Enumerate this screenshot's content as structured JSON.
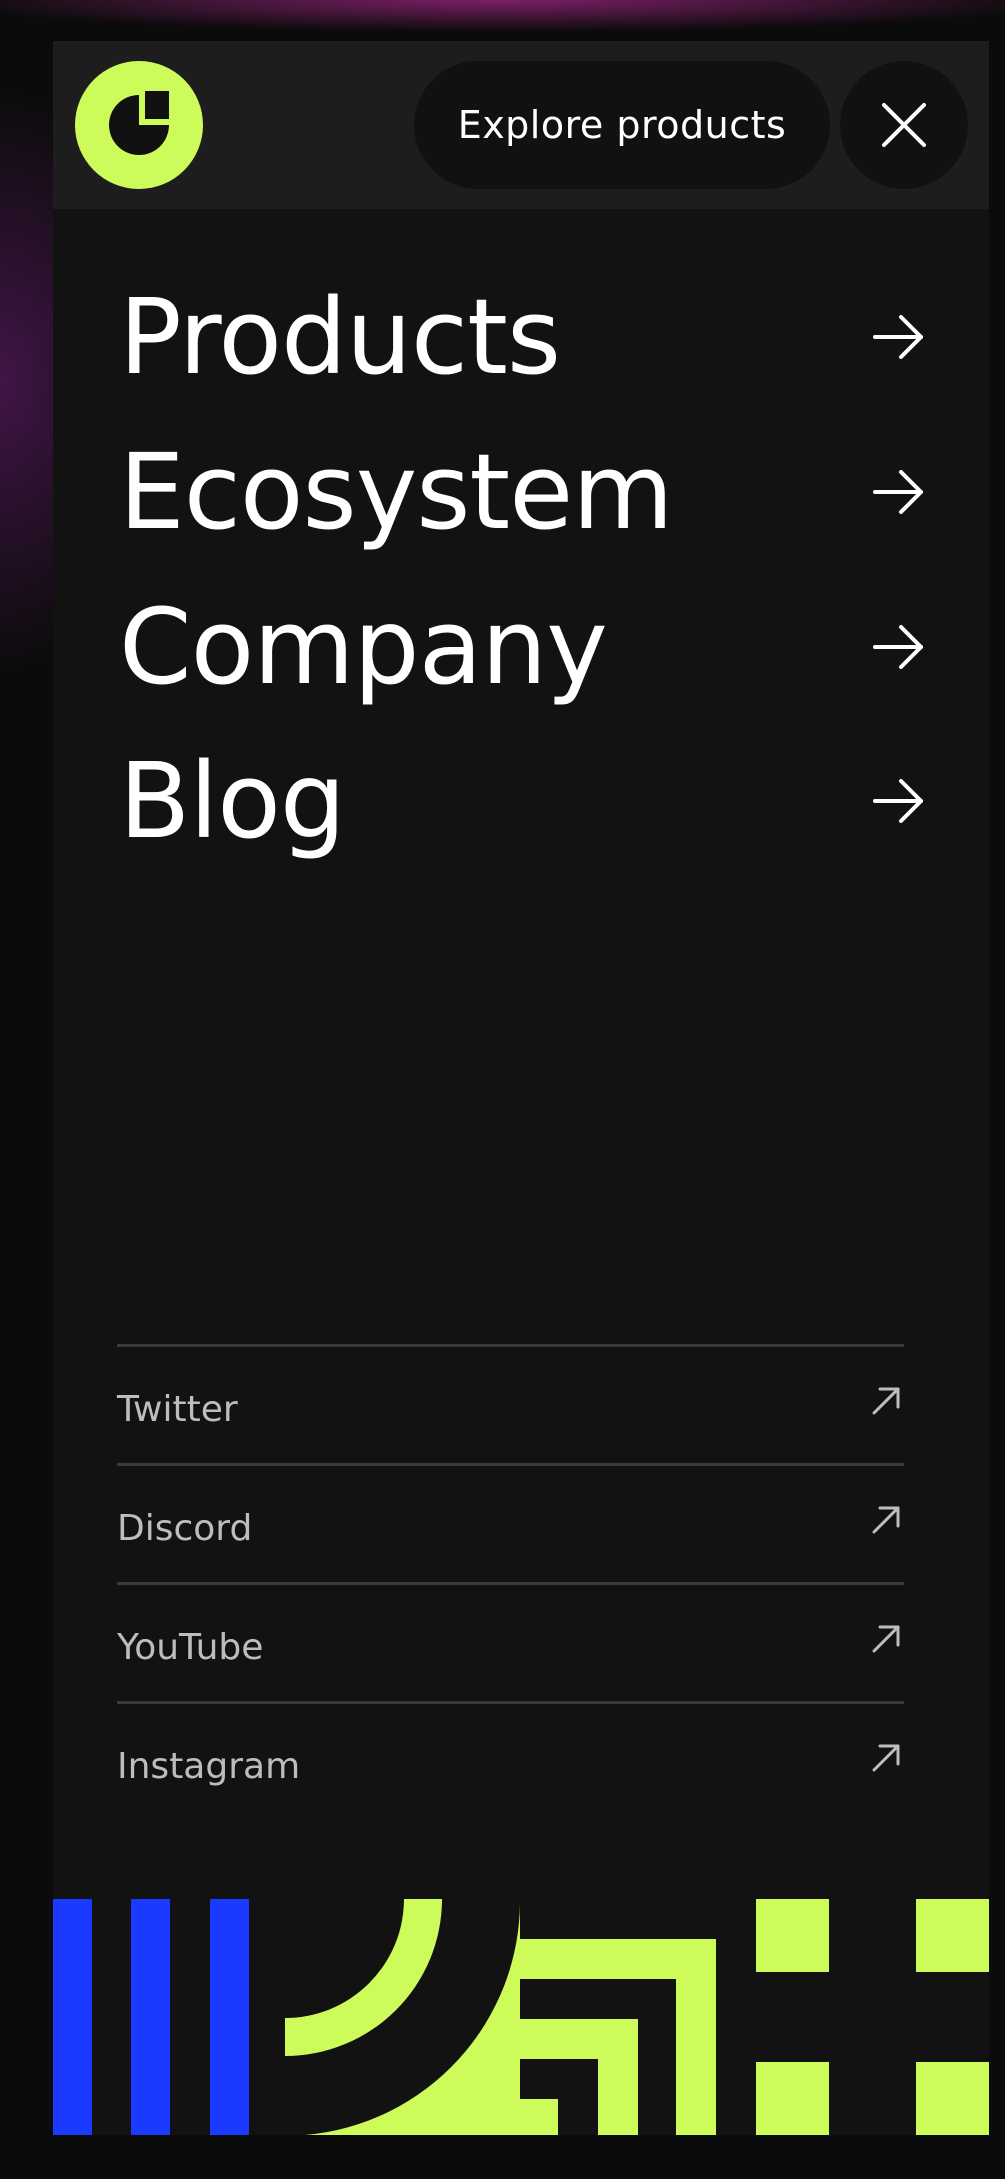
{
  "header": {
    "logo_icon": "brand-logo-icon",
    "explore_label": "Explore products",
    "close_icon": "close-icon"
  },
  "nav": {
    "items": [
      {
        "label": "Products",
        "icon": "arrow-right-icon"
      },
      {
        "label": "Ecosystem",
        "icon": "arrow-right-icon"
      },
      {
        "label": "Company",
        "icon": "arrow-right-icon"
      },
      {
        "label": "Blog",
        "icon": "arrow-right-icon"
      }
    ]
  },
  "social": {
    "items": [
      {
        "label": "Twitter",
        "icon": "external-link-icon"
      },
      {
        "label": "Discord",
        "icon": "external-link-icon"
      },
      {
        "label": "YouTube",
        "icon": "external-link-icon"
      },
      {
        "label": "Instagram",
        "icon": "external-link-icon"
      }
    ]
  },
  "colors": {
    "accent_lime": "#cdfb59",
    "accent_blue": "#1a3bff",
    "panel_bg": "#121212",
    "topbar_bg": "#1d1d1d",
    "text_primary": "#ffffff",
    "text_secondary": "#bdbdbd"
  }
}
